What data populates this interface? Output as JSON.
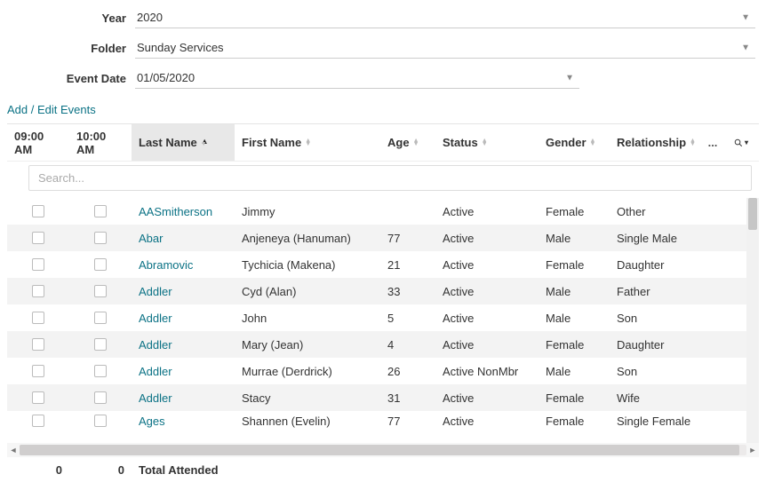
{
  "form": {
    "year": {
      "label": "Year",
      "value": "2020"
    },
    "folder": {
      "label": "Folder",
      "value": "Sunday Services"
    },
    "event_date": {
      "label": "Event Date",
      "value": "01/05/2020"
    }
  },
  "links": {
    "add_edit_events": "Add / Edit Events"
  },
  "columns": {
    "time1": "09:00 AM",
    "time2": "10:00 AM",
    "last_name": "Last Name",
    "first_name": "First Name",
    "age": "Age",
    "status": "Status",
    "gender": "Gender",
    "relationship": "Relationship",
    "more": "..."
  },
  "search": {
    "placeholder": "Search..."
  },
  "rows": [
    {
      "last": "AASmitherson",
      "first": "Jimmy",
      "age": "",
      "status": "Active",
      "gender": "Female",
      "rel": "Other"
    },
    {
      "last": "Abar",
      "first": "Anjeneya (Hanuman)",
      "age": "77",
      "status": "Active",
      "gender": "Male",
      "rel": "Single Male"
    },
    {
      "last": "Abramovic",
      "first": "Tychicia (Makena)",
      "age": "21",
      "status": "Active",
      "gender": "Female",
      "rel": "Daughter"
    },
    {
      "last": "Addler",
      "first": "Cyd (Alan)",
      "age": "33",
      "status": "Active",
      "gender": "Male",
      "rel": "Father"
    },
    {
      "last": "Addler",
      "first": "John",
      "age": "5",
      "status": "Active",
      "gender": "Male",
      "rel": "Son"
    },
    {
      "last": "Addler",
      "first": "Mary (Jean)",
      "age": "4",
      "status": "Active",
      "gender": "Female",
      "rel": "Daughter"
    },
    {
      "last": "Addler",
      "first": "Murrae (Derdrick)",
      "age": "26",
      "status": "Active NonMbr",
      "gender": "Male",
      "rel": "Son"
    },
    {
      "last": "Addler",
      "first": "Stacy",
      "age": "31",
      "status": "Active",
      "gender": "Female",
      "rel": "Wife"
    },
    {
      "last": "Ages",
      "first": "Shannen (Evelin)",
      "age": "77",
      "status": "Active",
      "gender": "Female",
      "rel": "Single Female"
    }
  ],
  "footer": {
    "time1_total": "0",
    "time2_total": "0",
    "label": "Total Attended"
  }
}
